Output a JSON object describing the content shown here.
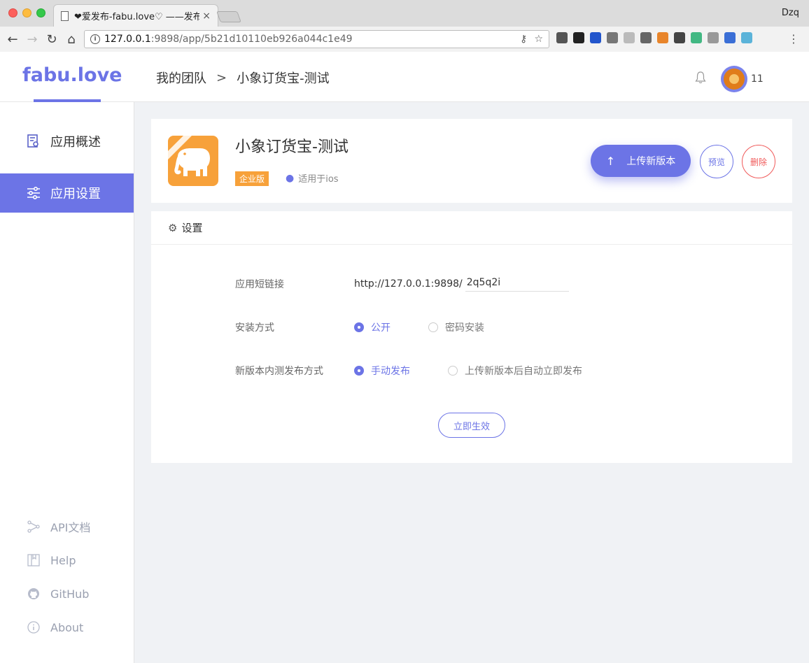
{
  "browser": {
    "tab_title": "❤爱发布-fabu.love♡ ——发布",
    "tab_close": "×",
    "user": "Dzq",
    "url_host": "127.0.0.1",
    "url_rest": ":9898/app/5b21d10110eb926a044c1e49",
    "info_icon": "i"
  },
  "header": {
    "logo": "fabu.love",
    "breadcrumb_team": "我的团队",
    "breadcrumb_sep": ">",
    "breadcrumb_app": "小象订货宝-测试",
    "user_count": "11",
    "accent_color": "#6c74e6"
  },
  "sidebar": {
    "items": [
      {
        "label": "应用概述",
        "icon": "app-overview-icon"
      },
      {
        "label": "应用设置",
        "icon": "sliders-icon"
      }
    ],
    "bottom": [
      {
        "label": "API文档",
        "icon": "share-nodes-icon"
      },
      {
        "label": "Help",
        "icon": "book-icon"
      },
      {
        "label": "GitHub",
        "icon": "github-icon"
      },
      {
        "label": "About",
        "icon": "info-icon"
      }
    ]
  },
  "app": {
    "name": "小象订货宝-测试",
    "badge": "企业版",
    "platform": "适用于ios",
    "upload_label": "上传新版本",
    "upload_arrow": "↑",
    "preview_label": "预览",
    "delete_label": "删除",
    "icon_color": "#f7a13a"
  },
  "settings": {
    "title": "设置",
    "short_link_label": "应用短链接",
    "short_link_prefix": "http://127.0.0.1:9898/",
    "short_link_value": "2q5q2i",
    "install_label": "安装方式",
    "install_options": [
      "公开",
      "密码安装"
    ],
    "install_selected": "公开",
    "release_label": "新版本内测发布方式",
    "release_options": [
      "手动发布",
      "上传新版本后自动立即发布"
    ],
    "release_selected": "手动发布",
    "apply_label": "立即生效"
  }
}
